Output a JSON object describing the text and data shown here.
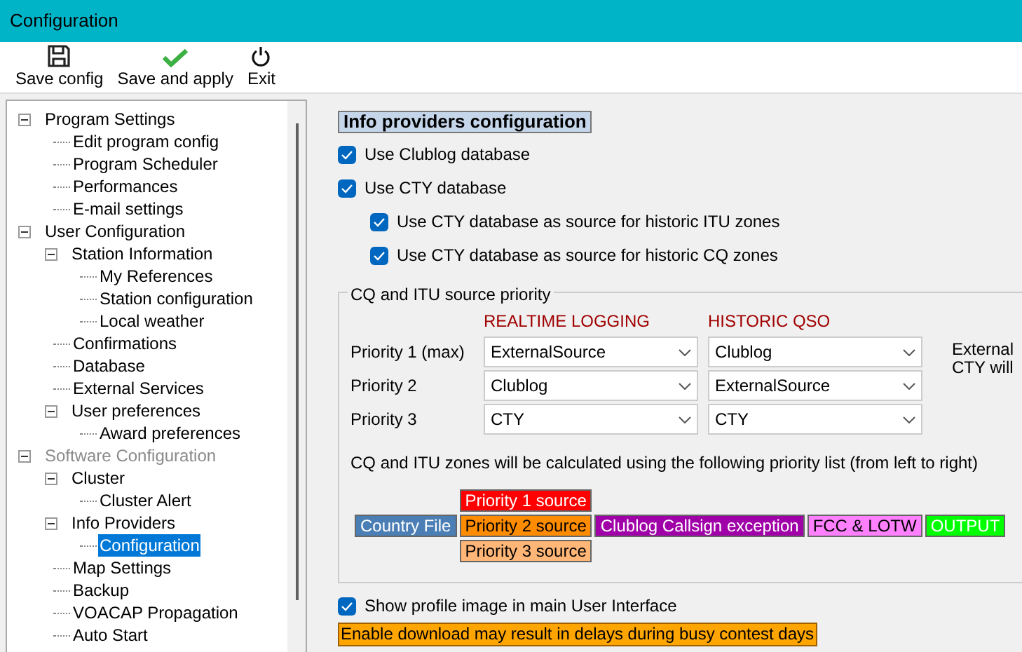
{
  "window": {
    "title": "Configuration"
  },
  "toolbar": [
    {
      "kind": "save",
      "label": "Save config"
    },
    {
      "kind": "apply",
      "label": "Save and apply"
    },
    {
      "kind": "exit",
      "label": "Exit"
    }
  ],
  "tree": [
    {
      "label": "Program Settings",
      "disabled": false,
      "selected": false,
      "expanded": true,
      "children": [
        {
          "label": "Edit program config",
          "disabled": false,
          "selected": false
        },
        {
          "label": "Program Scheduler",
          "disabled": false,
          "selected": false
        },
        {
          "label": "Performances",
          "disabled": false,
          "selected": false
        },
        {
          "label": "E-mail settings",
          "disabled": false,
          "selected": false
        }
      ]
    },
    {
      "label": "User Configuration",
      "disabled": false,
      "selected": false,
      "expanded": true,
      "children": [
        {
          "label": "Station Information",
          "disabled": false,
          "selected": false,
          "expanded": true,
          "children": [
            {
              "label": "My References",
              "disabled": false,
              "selected": false
            },
            {
              "label": "Station configuration",
              "disabled": false,
              "selected": false
            },
            {
              "label": "Local weather",
              "disabled": false,
              "selected": false
            }
          ]
        },
        {
          "label": "Confirmations",
          "disabled": false,
          "selected": false
        },
        {
          "label": "Database",
          "disabled": false,
          "selected": false
        },
        {
          "label": "External Services",
          "disabled": false,
          "selected": false
        },
        {
          "label": "User preferences",
          "disabled": false,
          "selected": false,
          "expanded": true,
          "children": [
            {
              "label": "Award preferences",
              "disabled": false,
              "selected": false
            }
          ]
        }
      ]
    },
    {
      "label": "Software Configuration",
      "disabled": true,
      "selected": false,
      "expanded": true,
      "children": [
        {
          "label": "Cluster",
          "disabled": false,
          "selected": false,
          "expanded": true,
          "children": [
            {
              "label": "Cluster Alert",
              "disabled": false,
              "selected": false
            }
          ]
        },
        {
          "label": "Info Providers",
          "disabled": false,
          "selected": false,
          "expanded": true,
          "children": [
            {
              "label": "Configuration",
              "disabled": false,
              "selected": true
            }
          ]
        },
        {
          "label": "Map Settings",
          "disabled": false,
          "selected": false
        },
        {
          "label": "Backup",
          "disabled": false,
          "selected": false
        },
        {
          "label": "VOACAP Propagation",
          "disabled": false,
          "selected": false
        },
        {
          "label": "Auto Start",
          "disabled": false,
          "selected": false
        }
      ]
    }
  ],
  "panel": {
    "heading": "Info providers configuration",
    "options": [
      {
        "label": "Use Clublog database",
        "checked": true,
        "indented": false
      },
      {
        "label": "Use CTY database",
        "checked": true,
        "indented": false
      },
      {
        "label": "Use CTY database as source for historic ITU zones",
        "checked": true,
        "indented": true
      },
      {
        "label": "Use CTY database as source for historic CQ zones",
        "checked": true,
        "indented": true
      }
    ],
    "priority_group": {
      "title": "CQ and ITU source priority",
      "column_headers": [
        "REALTIME LOGGING",
        "HISTORIC QSO"
      ],
      "rows": [
        {
          "label": "Priority 1 (max)",
          "realtime": "ExternalSource",
          "historic": "Clublog"
        },
        {
          "label": "Priority 2",
          "realtime": "Clublog",
          "historic": "ExternalSource"
        },
        {
          "label": "Priority 3",
          "realtime": "CTY",
          "historic": "CTY"
        }
      ],
      "side_note": [
        "External",
        "CTY will"
      ],
      "explanation": "CQ and ITU zones will be calculated using the following priority list (from left to right)",
      "flow": [
        {
          "kind": "single",
          "items": [
            {
              "label": "Country File",
              "color": "#4a7eb4"
            }
          ]
        },
        {
          "kind": "stack",
          "items": [
            {
              "label": "Priority 1 source",
              "color": "#ff0000"
            },
            {
              "label": "Priority 2 source",
              "color": "#ff8c00"
            },
            {
              "label": "Priority 3 source",
              "color": "#ffb677"
            }
          ]
        },
        {
          "kind": "single",
          "items": [
            {
              "label": "Clublog Callsign exception",
              "color": "#a000a8"
            }
          ]
        },
        {
          "kind": "single",
          "items": [
            {
              "label": "FCC & LOTW",
              "color": "#ff80ff"
            }
          ]
        },
        {
          "kind": "single",
          "items": [
            {
              "label": "OUTPUT",
              "color": "#00ff00"
            }
          ]
        }
      ]
    },
    "profile_option": {
      "label": "Show profile image in main User Interface",
      "checked": true
    },
    "warning": "Enable download may result in delays during busy contest days"
  }
}
